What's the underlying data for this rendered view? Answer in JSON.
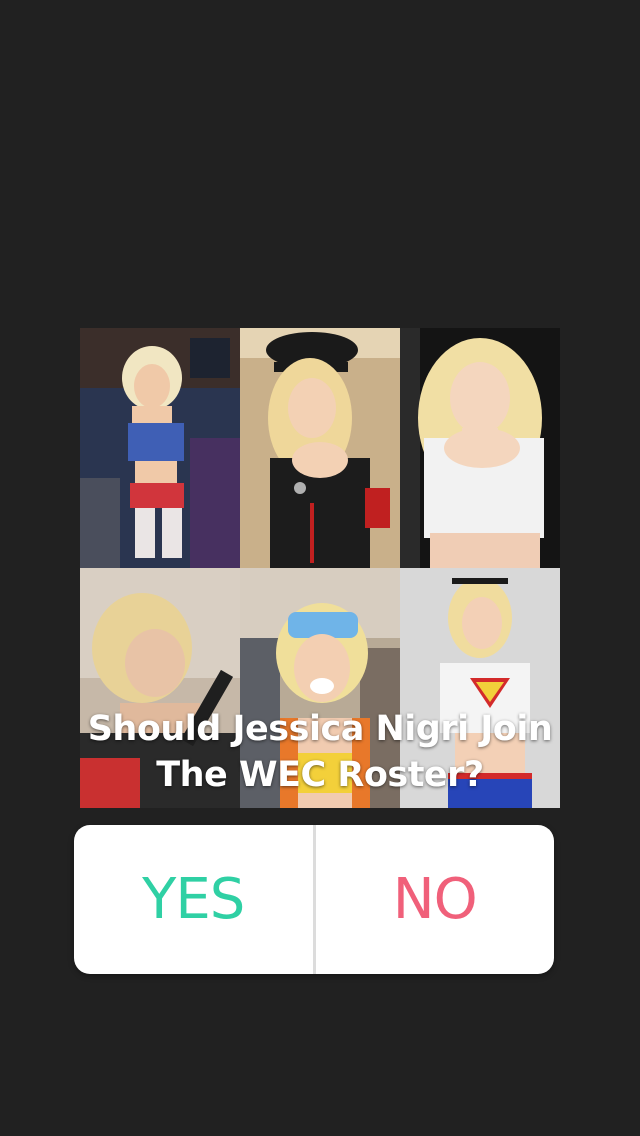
{
  "question": {
    "line1": "Should Jessica Nigri Join",
    "line2": "The WEC Roster?"
  },
  "poll": {
    "options": [
      "YES",
      "NO"
    ],
    "colors": {
      "yes": "#2fd0a4",
      "no": "#f0607a"
    }
  },
  "collage": {
    "photos": [
      {
        "name": "cosplay-photo-1"
      },
      {
        "name": "cosplay-photo-2"
      },
      {
        "name": "cosplay-photo-3"
      },
      {
        "name": "cosplay-photo-4"
      },
      {
        "name": "cosplay-photo-5"
      },
      {
        "name": "cosplay-photo-6"
      }
    ]
  }
}
